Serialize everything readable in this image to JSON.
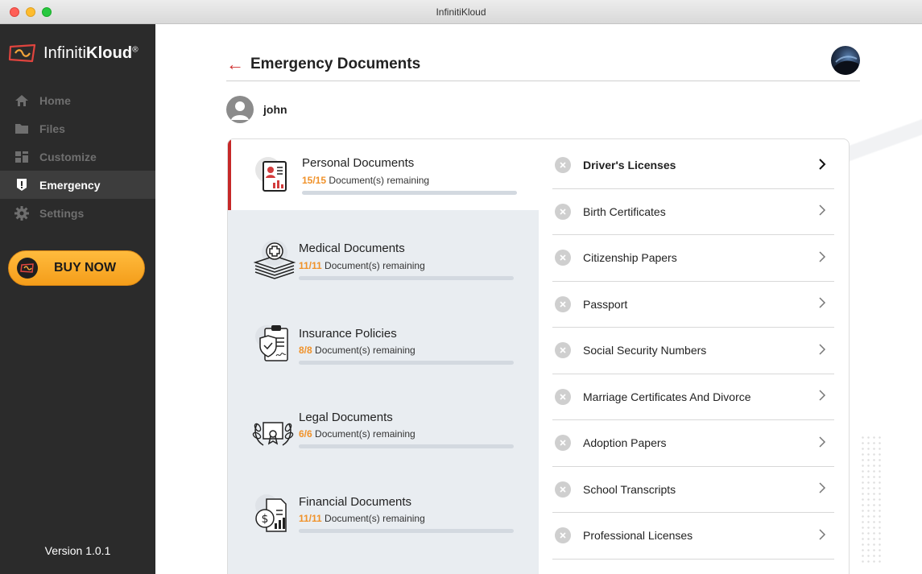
{
  "window": {
    "title": "InfinitiKloud"
  },
  "brand": {
    "name_light": "Infiniti",
    "name_bold": "Kloud",
    "mark": "®",
    "accent": "#c62828",
    "orange": "#f0922a"
  },
  "sidebar": {
    "items": [
      {
        "label": "Home",
        "icon": "home-icon",
        "active": false
      },
      {
        "label": "Files",
        "icon": "folder-icon",
        "active": false
      },
      {
        "label": "Customize",
        "icon": "customize-icon",
        "active": false
      },
      {
        "label": "Emergency",
        "icon": "alert-icon",
        "active": true
      },
      {
        "label": "Settings",
        "icon": "gear-icon",
        "active": false
      }
    ],
    "buy_now": "BUY NOW",
    "version": "Version 1.0.1"
  },
  "header": {
    "title": "Emergency Documents",
    "back_icon": "back-arrow-icon"
  },
  "user": {
    "name": "john"
  },
  "categories": [
    {
      "name": "Personal Documents",
      "count": "15/15",
      "remaining": " Document(s) remaining",
      "progress": 0,
      "active": true
    },
    {
      "name": "Medical Documents",
      "count": "11/11",
      "remaining": " Document(s) remaining",
      "progress": 0,
      "active": false
    },
    {
      "name": "Insurance Policies",
      "count": "8/8",
      "remaining": " Document(s) remaining",
      "progress": 0,
      "active": false
    },
    {
      "name": "Legal Documents",
      "count": "6/6",
      "remaining": " Document(s) remaining",
      "progress": 0,
      "active": false
    },
    {
      "name": "Financial Documents",
      "count": "11/11",
      "remaining": " Document(s) remaining",
      "progress": 0,
      "active": false
    }
  ],
  "documents": [
    {
      "label": "Driver's Licenses",
      "active": true
    },
    {
      "label": "Birth Certificates",
      "active": false
    },
    {
      "label": "Citizenship Papers",
      "active": false
    },
    {
      "label": "Passport",
      "active": false
    },
    {
      "label": "Social Security Numbers",
      "active": false
    },
    {
      "label": "Marriage Certificates And Divorce",
      "active": false
    },
    {
      "label": "Adoption Papers",
      "active": false
    },
    {
      "label": "School Transcripts",
      "active": false
    },
    {
      "label": "Professional Licenses",
      "active": false
    }
  ]
}
